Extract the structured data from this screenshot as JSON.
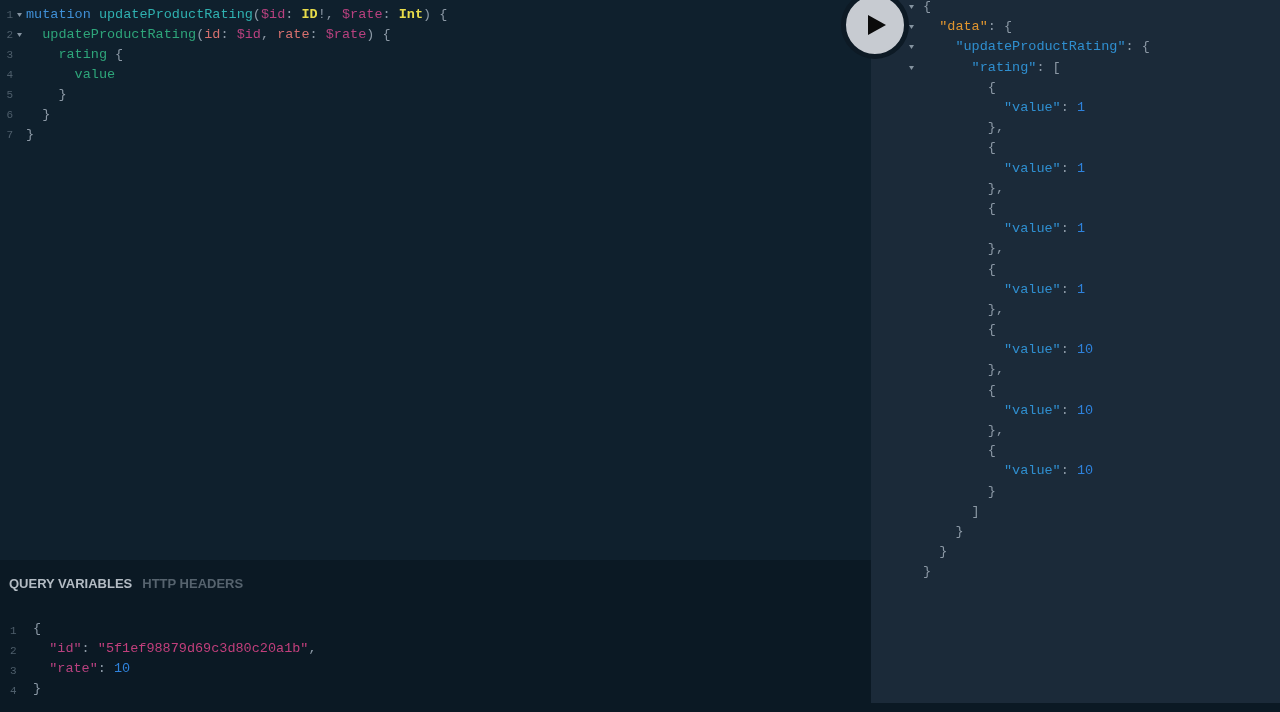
{
  "query_editor": {
    "lines": [
      {
        "number": "1",
        "foldable": true,
        "tokens": [
          {
            "kind": "keyword",
            "text": "mutation "
          },
          {
            "kind": "def",
            "text": "updateProductRating"
          },
          {
            "kind": "punct",
            "text": "("
          },
          {
            "kind": "variable",
            "text": "$id"
          },
          {
            "kind": "punct",
            "text": ": "
          },
          {
            "kind": "type",
            "text": "ID"
          },
          {
            "kind": "punct",
            "text": "!, "
          },
          {
            "kind": "variable",
            "text": "$rate"
          },
          {
            "kind": "punct",
            "text": ": "
          },
          {
            "kind": "type",
            "text": "Int"
          },
          {
            "kind": "punct",
            "text": ") {"
          }
        ]
      },
      {
        "number": "2",
        "foldable": true,
        "tokens": [
          {
            "kind": "field",
            "text": "updateProductRating"
          },
          {
            "kind": "punct",
            "text": "("
          },
          {
            "kind": "attr",
            "text": "id"
          },
          {
            "kind": "punct",
            "text": ": "
          },
          {
            "kind": "variable",
            "text": "$id"
          },
          {
            "kind": "punct",
            "text": ", "
          },
          {
            "kind": "attr",
            "text": "rate"
          },
          {
            "kind": "punct",
            "text": ": "
          },
          {
            "kind": "variable",
            "text": "$rate"
          },
          {
            "kind": "punct",
            "text": ") {"
          }
        ]
      },
      {
        "number": "3",
        "foldable": false,
        "tokens": [
          {
            "kind": "field",
            "text": "rating"
          },
          {
            "kind": "punct",
            "text": " {"
          }
        ]
      },
      {
        "number": "4",
        "foldable": false,
        "tokens": [
          {
            "kind": "field",
            "text": "value"
          }
        ]
      },
      {
        "number": "5",
        "foldable": false,
        "tokens": [
          {
            "kind": "punct",
            "text": "}"
          }
        ]
      },
      {
        "number": "6",
        "foldable": false,
        "tokens": [
          {
            "kind": "punct",
            "text": "}"
          }
        ]
      },
      {
        "number": "7",
        "foldable": false,
        "tokens": [
          {
            "kind": "punct",
            "text": "}"
          }
        ]
      }
    ]
  },
  "variables_panel": {
    "tabs": [
      {
        "label": "QUERY VARIABLES",
        "selected": true
      },
      {
        "label": "HTTP HEADERS",
        "selected": false
      }
    ],
    "lines": [
      {
        "number": "1",
        "tokens": [
          {
            "kind": "punct",
            "text": "{"
          }
        ]
      },
      {
        "number": "2",
        "tokens": [
          {
            "kind": "vproperty",
            "text": "\"id\""
          },
          {
            "kind": "punct",
            "text": ": "
          },
          {
            "kind": "string",
            "text": "\"5f1ef98879d69c3d80c20a1b\""
          },
          {
            "kind": "punct",
            "text": ","
          }
        ]
      },
      {
        "number": "3",
        "tokens": [
          {
            "kind": "vproperty",
            "text": "\"rate\""
          },
          {
            "kind": "punct",
            "text": ": "
          },
          {
            "kind": "number",
            "text": "10"
          }
        ]
      },
      {
        "number": "4",
        "tokens": [
          {
            "kind": "punct",
            "text": "}"
          }
        ]
      }
    ]
  },
  "result_panel": {
    "lines": [
      {
        "foldable": true,
        "tokens": [
          {
            "kind": "punct",
            "text": "{"
          }
        ]
      },
      {
        "foldable": true,
        "tokens": [
          {
            "kind": "datakey",
            "text": "\"data\""
          },
          {
            "kind": "punct",
            "text": ": {"
          }
        ]
      },
      {
        "foldable": true,
        "tokens": [
          {
            "kind": "property",
            "text": "\"updateProductRating\""
          },
          {
            "kind": "punct",
            "text": ": {"
          }
        ]
      },
      {
        "foldable": true,
        "tokens": [
          {
            "kind": "property",
            "text": "\"rating\""
          },
          {
            "kind": "punct",
            "text": ": ["
          }
        ]
      },
      {
        "foldable": false,
        "tokens": [
          {
            "kind": "punct",
            "text": "{"
          }
        ]
      },
      {
        "foldable": false,
        "tokens": [
          {
            "kind": "property",
            "text": "\"value\""
          },
          {
            "kind": "punct",
            "text": ": "
          },
          {
            "kind": "number",
            "text": "1"
          }
        ]
      },
      {
        "foldable": false,
        "tokens": [
          {
            "kind": "punct",
            "text": "},"
          }
        ]
      },
      {
        "foldable": false,
        "tokens": [
          {
            "kind": "punct",
            "text": "{"
          }
        ]
      },
      {
        "foldable": false,
        "tokens": [
          {
            "kind": "property",
            "text": "\"value\""
          },
          {
            "kind": "punct",
            "text": ": "
          },
          {
            "kind": "number",
            "text": "1"
          }
        ]
      },
      {
        "foldable": false,
        "tokens": [
          {
            "kind": "punct",
            "text": "},"
          }
        ]
      },
      {
        "foldable": false,
        "tokens": [
          {
            "kind": "punct",
            "text": "{"
          }
        ]
      },
      {
        "foldable": false,
        "tokens": [
          {
            "kind": "property",
            "text": "\"value\""
          },
          {
            "kind": "punct",
            "text": ": "
          },
          {
            "kind": "number",
            "text": "1"
          }
        ]
      },
      {
        "foldable": false,
        "tokens": [
          {
            "kind": "punct",
            "text": "},"
          }
        ]
      },
      {
        "foldable": false,
        "tokens": [
          {
            "kind": "punct",
            "text": "{"
          }
        ]
      },
      {
        "foldable": false,
        "tokens": [
          {
            "kind": "property",
            "text": "\"value\""
          },
          {
            "kind": "punct",
            "text": ": "
          },
          {
            "kind": "number",
            "text": "1"
          }
        ]
      },
      {
        "foldable": false,
        "tokens": [
          {
            "kind": "punct",
            "text": "},"
          }
        ]
      },
      {
        "foldable": false,
        "tokens": [
          {
            "kind": "punct",
            "text": "{"
          }
        ]
      },
      {
        "foldable": false,
        "tokens": [
          {
            "kind": "property",
            "text": "\"value\""
          },
          {
            "kind": "punct",
            "text": ": "
          },
          {
            "kind": "number",
            "text": "10"
          }
        ]
      },
      {
        "foldable": false,
        "tokens": [
          {
            "kind": "punct",
            "text": "},"
          }
        ]
      },
      {
        "foldable": false,
        "tokens": [
          {
            "kind": "punct",
            "text": "{"
          }
        ]
      },
      {
        "foldable": false,
        "tokens": [
          {
            "kind": "property",
            "text": "\"value\""
          },
          {
            "kind": "punct",
            "text": ": "
          },
          {
            "kind": "number",
            "text": "10"
          }
        ]
      },
      {
        "foldable": false,
        "tokens": [
          {
            "kind": "punct",
            "text": "},"
          }
        ]
      },
      {
        "foldable": false,
        "tokens": [
          {
            "kind": "punct",
            "text": "{"
          }
        ]
      },
      {
        "foldable": false,
        "tokens": [
          {
            "kind": "property",
            "text": "\"value\""
          },
          {
            "kind": "punct",
            "text": ": "
          },
          {
            "kind": "number",
            "text": "10"
          }
        ]
      },
      {
        "foldable": false,
        "tokens": [
          {
            "kind": "punct",
            "text": "}"
          }
        ]
      },
      {
        "foldable": false,
        "tokens": [
          {
            "kind": "punct",
            "text": "]"
          }
        ]
      },
      {
        "foldable": false,
        "tokens": [
          {
            "kind": "punct",
            "text": "}"
          }
        ]
      },
      {
        "foldable": false,
        "tokens": [
          {
            "kind": "punct",
            "text": "}"
          }
        ]
      },
      {
        "foldable": false,
        "tokens": [
          {
            "kind": "punct",
            "text": "}"
          }
        ]
      }
    ]
  }
}
